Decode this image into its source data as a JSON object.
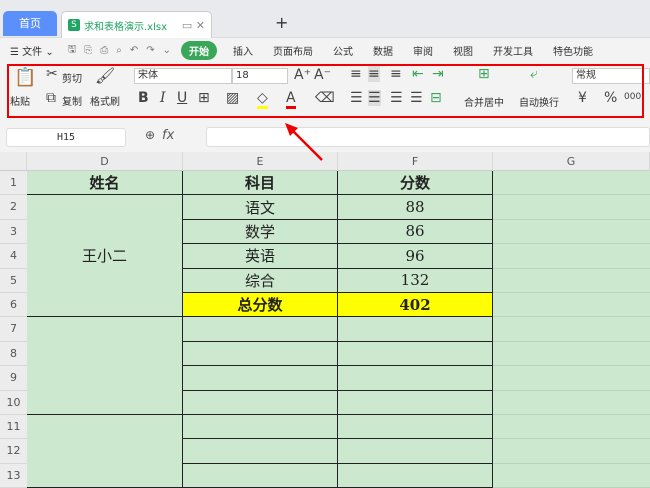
{
  "tabs": {
    "home": "首页",
    "file": "求和表格演示.xlsx",
    "file_icon": "S",
    "new_tab": "+"
  },
  "menu": {
    "file": "文件",
    "start": "开始",
    "items": [
      "插入",
      "页面布局",
      "公式",
      "数据",
      "审阅",
      "视图",
      "开发工具",
      "特色功能"
    ]
  },
  "ribbon": {
    "paste": "粘贴",
    "cut": "剪切",
    "copy": "复制",
    "format_painter": "格式刷",
    "font_name": "宋体",
    "font_size": "18",
    "bold": "B",
    "italic": "I",
    "underline": "U",
    "font_color": "A",
    "merge_center": "合并居中",
    "wrap_text": "自动换行",
    "number_format": "常规",
    "currency": "¥",
    "percent": "%",
    "thousands": "000"
  },
  "formula": {
    "name_box": "H15",
    "fx": "fx",
    "value": ""
  },
  "columns": [
    "D",
    "E",
    "F",
    "G"
  ],
  "rows": [
    "1",
    "2",
    "3",
    "4",
    "5",
    "6",
    "7",
    "8",
    "9",
    "10",
    "11",
    "12",
    "13"
  ],
  "table": {
    "header": [
      "姓名",
      "科目",
      "分数"
    ],
    "name": "王小二",
    "subjects": [
      "语文",
      "数学",
      "英语",
      "综合"
    ],
    "scores": [
      "88",
      "86",
      "96",
      "132"
    ],
    "total_label": "总分数",
    "total": "402"
  },
  "colors": {
    "cell_bg": "#cce8cf",
    "highlight": "#ffff00",
    "accent": "#3aa65a",
    "annotation": "#e00000"
  }
}
